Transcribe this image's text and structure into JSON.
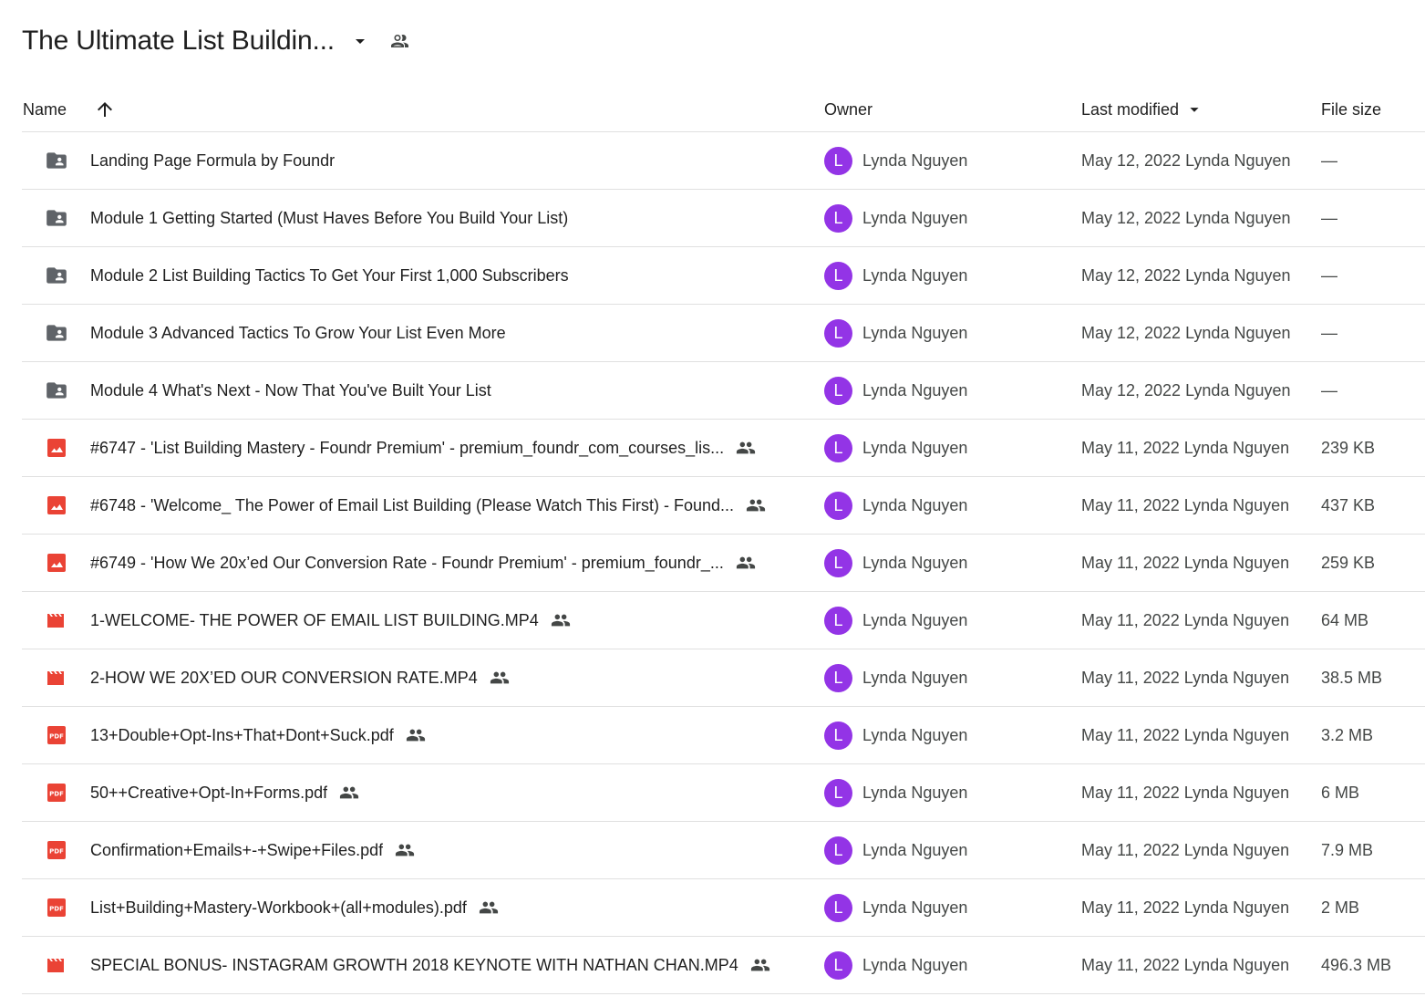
{
  "header": {
    "title": "The Ultimate List Buildin...",
    "title_dropdown_icon": "arrow-drop-down-icon",
    "shared_icon": "people-outline-icon"
  },
  "columns": {
    "name": "Name",
    "owner": "Owner",
    "last_modified": "Last modified",
    "file_size": "File size",
    "sort_icon": "arrow-upward-icon"
  },
  "colors": {
    "avatar": "#9334e6",
    "folder_icon": "#5f6368",
    "file_icon_red": "#ea4335",
    "divider": "#e0e0e0"
  },
  "files": [
    {
      "type": "shared-folder",
      "name": "Landing Page Formula by Foundr",
      "shared": false,
      "owner_initial": "L",
      "owner": "Lynda Nguyen",
      "modified": "May 12, 2022 Lynda Nguyen",
      "size": "—"
    },
    {
      "type": "shared-folder",
      "name": "Module 1 Getting Started (Must Haves Before You Build Your List)",
      "shared": false,
      "owner_initial": "L",
      "owner": "Lynda Nguyen",
      "modified": "May 12, 2022 Lynda Nguyen",
      "size": "—"
    },
    {
      "type": "shared-folder",
      "name": "Module 2 List Building Tactics To Get Your First 1,000 Subscribers",
      "shared": false,
      "owner_initial": "L",
      "owner": "Lynda Nguyen",
      "modified": "May 12, 2022 Lynda Nguyen",
      "size": "—"
    },
    {
      "type": "shared-folder",
      "name": "Module 3 Advanced Tactics To Grow Your List Even More",
      "shared": false,
      "owner_initial": "L",
      "owner": "Lynda Nguyen",
      "modified": "May 12, 2022 Lynda Nguyen",
      "size": "—"
    },
    {
      "type": "shared-folder",
      "name": "Module 4 What's Next - Now That You've Built Your List",
      "shared": false,
      "owner_initial": "L",
      "owner": "Lynda Nguyen",
      "modified": "May 12, 2022 Lynda Nguyen",
      "size": "—"
    },
    {
      "type": "image",
      "name": "#6747 - 'List Building Mastery - Foundr Premium' - premium_foundr_com_courses_lis...",
      "shared": true,
      "owner_initial": "L",
      "owner": "Lynda Nguyen",
      "modified": "May 11, 2022 Lynda Nguyen",
      "size": "239 KB"
    },
    {
      "type": "image",
      "name": "#6748 - 'Welcome_ The Power of Email List Building (Please Watch This First) - Found...",
      "shared": true,
      "owner_initial": "L",
      "owner": "Lynda Nguyen",
      "modified": "May 11, 2022 Lynda Nguyen",
      "size": "437 KB"
    },
    {
      "type": "image",
      "name": "#6749 - 'How We 20x’ed Our Conversion Rate - Foundr Premium' - premium_foundr_...",
      "shared": true,
      "owner_initial": "L",
      "owner": "Lynda Nguyen",
      "modified": "May 11, 2022 Lynda Nguyen",
      "size": "259 KB"
    },
    {
      "type": "video",
      "name": "1-WELCOME- THE POWER OF EMAIL LIST BUILDING.MP4",
      "shared": true,
      "owner_initial": "L",
      "owner": "Lynda Nguyen",
      "modified": "May 11, 2022 Lynda Nguyen",
      "size": "64 MB"
    },
    {
      "type": "video",
      "name": "2-HOW WE 20X’ED OUR CONVERSION RATE.MP4",
      "shared": true,
      "owner_initial": "L",
      "owner": "Lynda Nguyen",
      "modified": "May 11, 2022 Lynda Nguyen",
      "size": "38.5 MB"
    },
    {
      "type": "pdf",
      "name": "13+Double+Opt-Ins+That+Dont+Suck.pdf",
      "shared": true,
      "owner_initial": "L",
      "owner": "Lynda Nguyen",
      "modified": "May 11, 2022 Lynda Nguyen",
      "size": "3.2 MB"
    },
    {
      "type": "pdf",
      "name": "50++Creative+Opt-In+Forms.pdf",
      "shared": true,
      "owner_initial": "L",
      "owner": "Lynda Nguyen",
      "modified": "May 11, 2022 Lynda Nguyen",
      "size": "6 MB"
    },
    {
      "type": "pdf",
      "name": "Confirmation+Emails+-+Swipe+Files.pdf",
      "shared": true,
      "owner_initial": "L",
      "owner": "Lynda Nguyen",
      "modified": "May 11, 2022 Lynda Nguyen",
      "size": "7.9 MB"
    },
    {
      "type": "pdf",
      "name": "List+Building+Mastery-Workbook+(all+modules).pdf",
      "shared": true,
      "owner_initial": "L",
      "owner": "Lynda Nguyen",
      "modified": "May 11, 2022 Lynda Nguyen",
      "size": "2 MB"
    },
    {
      "type": "video",
      "name": "SPECIAL BONUS- INSTAGRAM GROWTH 2018 KEYNOTE WITH NATHAN CHAN.MP4",
      "shared": true,
      "owner_initial": "L",
      "owner": "Lynda Nguyen",
      "modified": "May 11, 2022 Lynda Nguyen",
      "size": "496.3 MB"
    }
  ]
}
